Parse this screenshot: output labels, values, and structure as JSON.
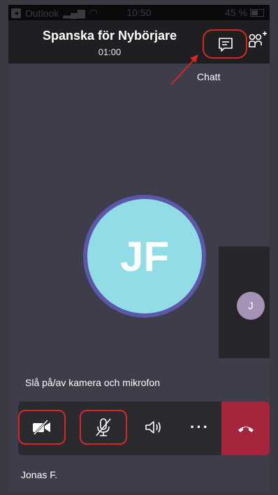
{
  "status_bar": {
    "carrier": "Outlook",
    "time": "10:50",
    "battery": "45 %"
  },
  "header": {
    "title": "Spanska för Nybörjare",
    "timer": "01:00"
  },
  "annotation": {
    "chat_label": "Chatt"
  },
  "participants": {
    "main_initials": "JF",
    "side_initials": "J"
  },
  "caption": "Slå på/av kamera och mikrofon",
  "self_name": "Jonas F.",
  "icons": {
    "chat": "chat-icon",
    "people": "add-people-icon",
    "camera": "camera-off-icon",
    "mic": "mic-off-icon",
    "speaker": "speaker-icon",
    "more": "more-icon",
    "hangup": "hang-up-icon"
  },
  "colors": {
    "accent_annotation": "#d7281f",
    "hangup": "#a3263c",
    "avatar_main": "#91dde5",
    "avatar_ring": "#5c57a8",
    "avatar_small": "#a493b5"
  }
}
